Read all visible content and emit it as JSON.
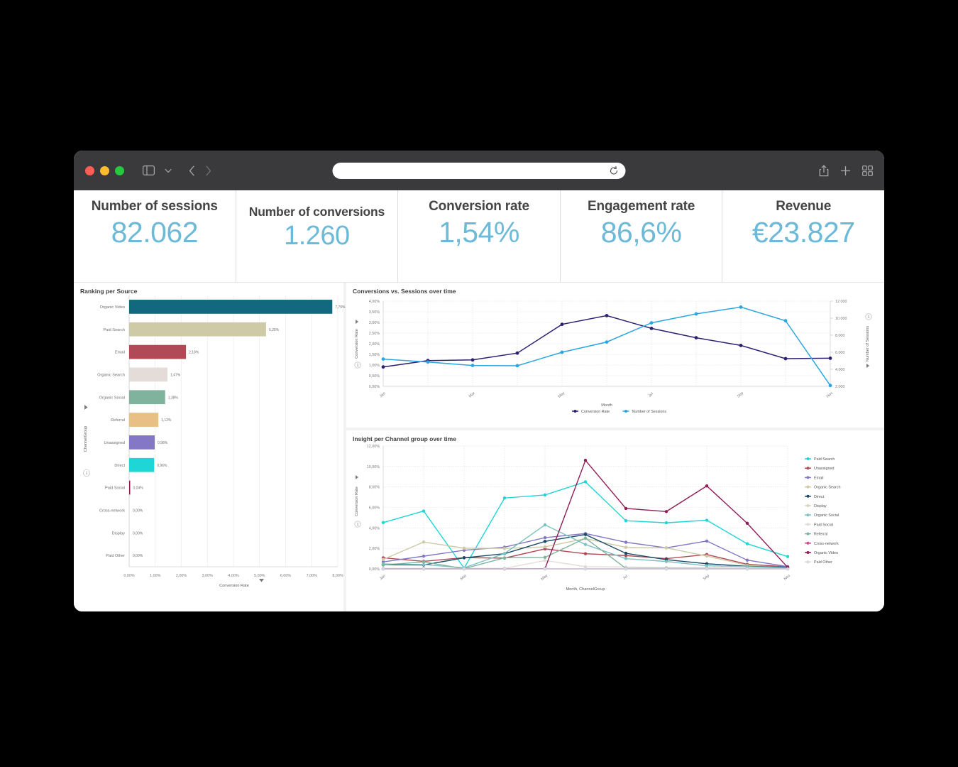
{
  "browser": {
    "address_value": "",
    "address_placeholder": "",
    "icons": {
      "sidebar": "sidebar-icon",
      "chevron_down": "chevron-down-icon",
      "back": "back-arrow-icon",
      "forward": "forward-arrow-icon",
      "reload": "reload-icon",
      "share": "share-icon",
      "new_tab": "plus-icon",
      "tab_overview": "tab-overview-icon"
    }
  },
  "kpis": [
    {
      "title": "Number of sessions",
      "value": "82.062"
    },
    {
      "title": "Number of conversions",
      "value": "1.260"
    },
    {
      "title": "Conversion rate",
      "value": "1,54%"
    },
    {
      "title": "Engagement rate",
      "value": "86,6%"
    },
    {
      "title": "Revenue",
      "value": "€23.827"
    }
  ],
  "accent_color": "#6cb9d8",
  "chart_data": [
    {
      "type": "bar",
      "title": "Ranking per Source",
      "orientation": "horizontal",
      "xlabel": "Conversion Rate",
      "ylabel": "ChannelGroup",
      "xlim": [
        0,
        8
      ],
      "xticks": [
        "0,00%",
        "1,00%",
        "2,00%",
        "3,00%",
        "4,00%",
        "5,00%",
        "6,00%",
        "7,00%",
        "8,00%"
      ],
      "categories": [
        "Organic Video",
        "Paid Search",
        "Email",
        "Organic Search",
        "Organic Social",
        "Referral",
        "Unassigned",
        "Direct",
        "Paid Social",
        "Cross-network",
        "Display",
        "Paid Other"
      ],
      "values": [
        7.79,
        5.25,
        2.18,
        1.47,
        1.38,
        1.12,
        0.98,
        0.96,
        0.04,
        0.0,
        0.0,
        0.0
      ],
      "value_labels": [
        "7,79%",
        "5,25%",
        "2,18%",
        "1,47%",
        "1,38%",
        "1,12%",
        "0,98%",
        "0,96%",
        "0,04%",
        "0,00%",
        "0,00%",
        "0,00%"
      ],
      "colors": [
        "#11687f",
        "#cdcaa5",
        "#b04a57",
        "#e3dcd8",
        "#7fb39d",
        "#e8bf85",
        "#8377c6",
        "#1ed6d6",
        "#8e1b56",
        "#cf4a8d",
        "#d9d4c0",
        "#cfd9e2"
      ]
    },
    {
      "type": "line",
      "title": "Conversions vs. Sessions over time",
      "xlabel": "Month",
      "ylabel": "Conversion Rate",
      "y2label": "Number of Sessions",
      "ylim": [
        0,
        4
      ],
      "yticks": [
        "0,00%",
        "0,50%",
        "1,00%",
        "1,50%",
        "2,00%",
        "2,50%",
        "3,00%",
        "3,50%",
        "4,00%"
      ],
      "y2lim": [
        2000,
        12000
      ],
      "y2ticks": [
        "2.000",
        "4.000",
        "6.000",
        "8.000",
        "10.000",
        "12.000"
      ],
      "x": [
        "Jan",
        "Feb",
        "Mar",
        "Apr",
        "May",
        "Jun",
        "Jul",
        "Aug",
        "Sep",
        "Oct",
        "Nov"
      ],
      "xticks_shown": [
        "Jan",
        "Mar",
        "May",
        "Jul",
        "Sep",
        "Nov"
      ],
      "series": [
        {
          "name": "Conversion Rate",
          "color": "#2b2172",
          "axis": "left",
          "values": [
            0.91,
            1.21,
            1.24,
            1.56,
            2.91,
            3.32,
            2.72,
            2.28,
            1.92,
            1.3,
            1.32
          ]
        },
        {
          "name": "Number of Sessions",
          "color": "#2ba6e0",
          "axis": "right",
          "values": [
            5200,
            4850,
            4450,
            4420,
            6000,
            7200,
            9450,
            10500,
            11300,
            9700,
            2100
          ]
        }
      ]
    },
    {
      "type": "line",
      "title": "Insight per Channel group over time",
      "xlabel": "Month, ChannelGroup",
      "ylabel": "Conversion Rate",
      "ylim": [
        0,
        12
      ],
      "yticks": [
        "0,00%",
        "2,00%",
        "4,00%",
        "6,00%",
        "8,00%",
        "10,00%",
        "12,00%"
      ],
      "x": [
        "Jan",
        "Feb",
        "Mar",
        "Apr",
        "May",
        "Jun",
        "Jul",
        "Aug",
        "Sep",
        "Oct",
        "Nov"
      ],
      "xticks_shown": [
        "Jan",
        "Mar",
        "May",
        "Jul",
        "Sep",
        "Nov"
      ],
      "legend_position": "right",
      "series": [
        {
          "name": "Paid Search",
          "color": "#1ed6d6",
          "values": [
            4.52,
            5.65,
            0.07,
            6.92,
            7.22,
            8.5,
            4.7,
            4.5,
            4.75,
            2.45,
            1.2
          ]
        },
        {
          "name": "Unassigned",
          "color": "#b04a57",
          "values": [
            1.08,
            0.73,
            1.1,
            1.05,
            1.95,
            1.48,
            1.3,
            1.0,
            1.4,
            0.45,
            0.2
          ]
        },
        {
          "name": "Email",
          "color": "#8377c6",
          "values": [
            0.68,
            1.24,
            1.82,
            2.12,
            3.05,
            3.45,
            2.6,
            2.05,
            2.72,
            0.85,
            0.22
          ]
        },
        {
          "name": "Organic Search",
          "color": "#cdcaa5",
          "values": [
            0.92,
            2.62,
            2.02,
            2.0,
            2.15,
            2.96,
            2.1,
            2.05,
            1.25,
            0.35,
            0.12
          ]
        },
        {
          "name": "Direct",
          "color": "#1a4b66",
          "values": [
            0.4,
            0.38,
            1.08,
            1.48,
            2.68,
            3.35,
            1.52,
            0.9,
            0.5,
            0.25,
            0.15
          ]
        },
        {
          "name": "Display",
          "color": "#d9d4c0",
          "values": [
            0.0,
            0.0,
            0.0,
            0.0,
            0.0,
            0.0,
            0.0,
            0.0,
            0.0,
            0.0,
            0.0
          ]
        },
        {
          "name": "Organic Social",
          "color": "#7bc2c2",
          "values": [
            0.48,
            0.42,
            0.1,
            1.5,
            4.3,
            2.38,
            1.0,
            0.72,
            0.3,
            0.22,
            0.1
          ]
        },
        {
          "name": "Paid Social",
          "color": "#e3dcd8",
          "values": [
            0.05,
            0.05,
            0.05,
            0.05,
            0.82,
            0.22,
            0.18,
            0.12,
            0.08,
            0.05,
            0.04
          ]
        },
        {
          "name": "Referral",
          "color": "#7fb39d",
          "values": [
            0.38,
            0.68,
            0.02,
            1.08,
            1.12,
            3.0,
            0.05,
            0.05,
            0.05,
            0.05,
            0.05
          ]
        },
        {
          "name": "Cross-network",
          "color": "#cf4a8d",
          "values": [
            0.0,
            0.0,
            0.0,
            0.0,
            0.0,
            0.0,
            0.0,
            0.0,
            0.0,
            0.0,
            0.0
          ]
        },
        {
          "name": "Organic Video",
          "color": "#8e1b56",
          "values": [
            0.0,
            0.0,
            0.0,
            0.0,
            0.02,
            10.6,
            5.9,
            5.6,
            8.1,
            4.45,
            0.15
          ]
        },
        {
          "name": "Paid Other",
          "color": "#cfd9e2",
          "values": [
            0.0,
            0.0,
            0.0,
            0.0,
            0.0,
            0.0,
            0.0,
            0.0,
            0.0,
            0.0,
            0.0
          ]
        }
      ]
    }
  ]
}
